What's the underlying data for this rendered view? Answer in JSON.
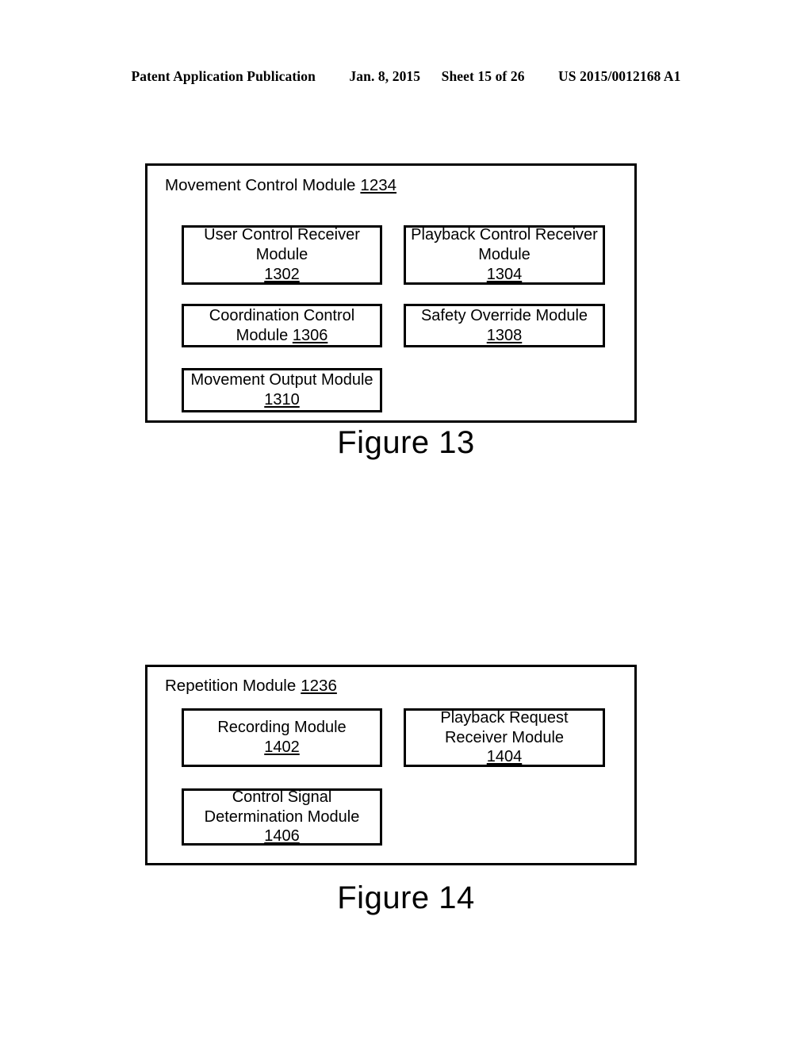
{
  "header": {
    "publication": "Patent Application Publication",
    "date": "Jan. 8, 2015",
    "sheet": "Sheet 15 of 26",
    "patent_number": "US 2015/0012168 A1"
  },
  "figures": [
    {
      "caption": "Figure 13",
      "title": "Movement Control Module",
      "title_ref": "1234",
      "boxes": [
        {
          "line1": "User Control Receiver",
          "line2": "Module",
          "ref": "1302"
        },
        {
          "line1": "Playback Control Receiver",
          "line2": "Module",
          "ref": "1304"
        },
        {
          "line1": "Coordination Control",
          "line2": "Module ",
          "ref": "1306"
        },
        {
          "line1": "Safety Override Module",
          "line2": "",
          "ref": "1308"
        },
        {
          "line1": "Movement Output Module",
          "line2": "",
          "ref": "1310"
        }
      ]
    },
    {
      "caption": "Figure 14",
      "title": "Repetition Module",
      "title_ref": "1236",
      "boxes": [
        {
          "line1": "Recording Module",
          "line2": "",
          "ref": "1402"
        },
        {
          "line1": "Playback Request",
          "line2": "Receiver Module",
          "ref": "1404"
        },
        {
          "line1": "Control Signal",
          "line2": "Determination Module",
          "ref": "1406"
        }
      ]
    }
  ],
  "colors": {
    "line": "#000000",
    "background": "#ffffff",
    "text": "#000000"
  }
}
